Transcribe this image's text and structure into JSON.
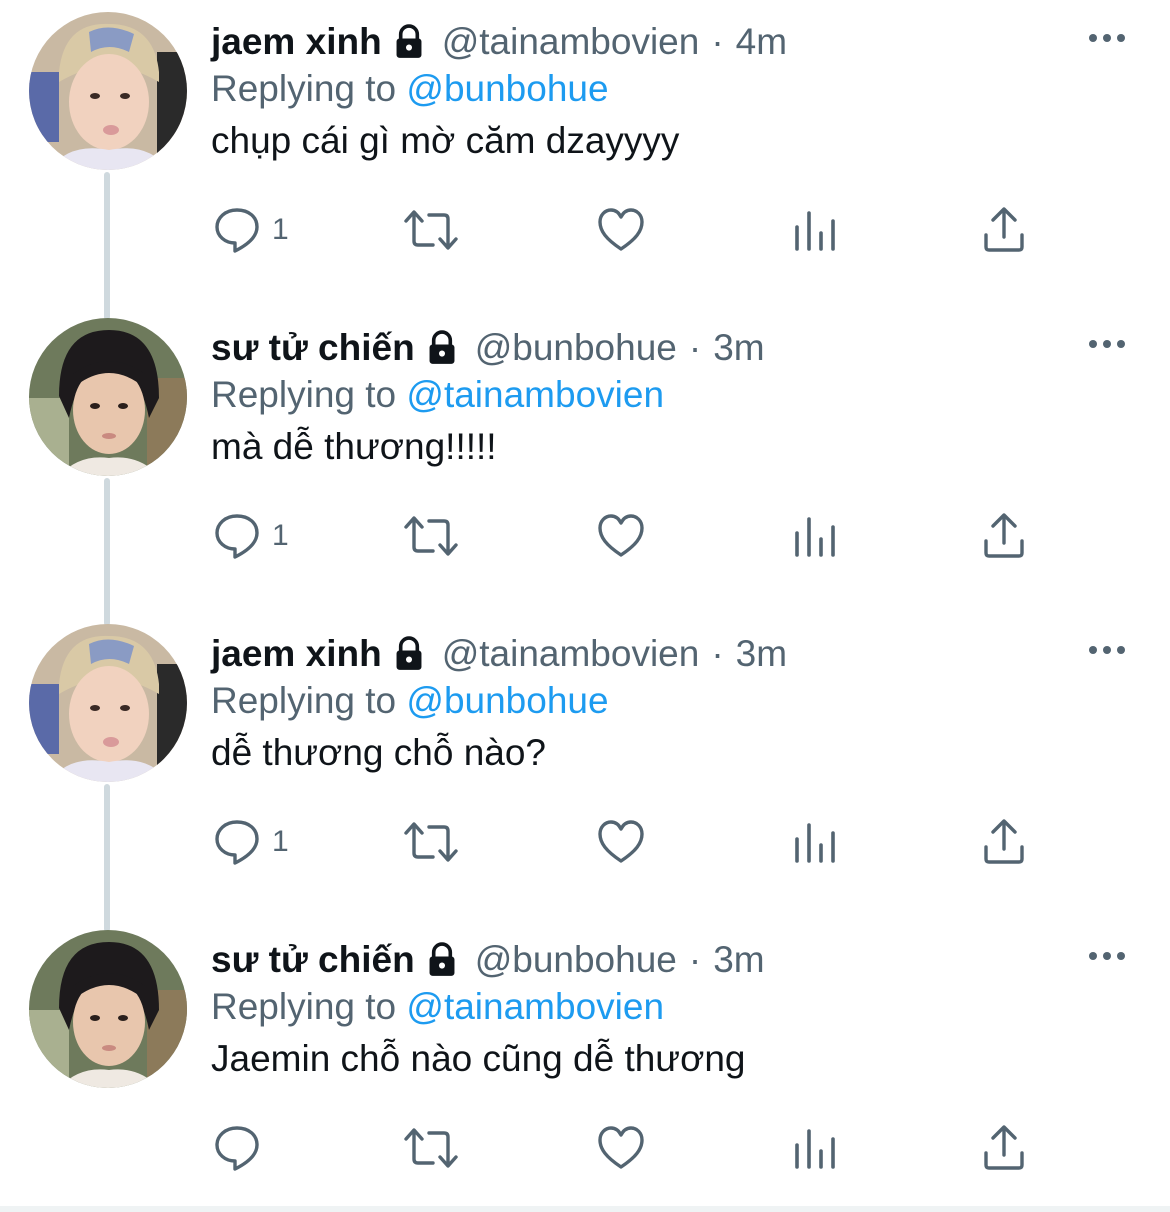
{
  "tweets": [
    {
      "name": "jaem xinh",
      "handle": "@tainambovien",
      "dot": "·",
      "time": "4m",
      "replying_prefix": "Replying to ",
      "replying_to": "@bunbohue",
      "text": "chụp cái gì mờ căm dzayyyy",
      "reply_count": "1",
      "avatar": "jaem"
    },
    {
      "name": "sư tử chiến",
      "handle": "@bunbohue",
      "dot": "·",
      "time": "3m",
      "replying_prefix": "Replying to ",
      "replying_to": "@tainambovien",
      "text": "mà dễ thương!!!!!",
      "reply_count": "1",
      "avatar": "chien"
    },
    {
      "name": "jaem xinh",
      "handle": "@tainambovien",
      "dot": "·",
      "time": "3m",
      "replying_prefix": "Replying to ",
      "replying_to": "@bunbohue",
      "text": "dễ thương chỗ nào?",
      "reply_count": "1",
      "avatar": "jaem"
    },
    {
      "name": "sư tử chiến",
      "handle": "@bunbohue",
      "dot": "·",
      "time": "3m",
      "replying_prefix": "Replying to ",
      "replying_to": "@tainambovien",
      "text": "Jaemin chỗ nào cũng dễ thương",
      "reply_count": "",
      "avatar": "chien"
    }
  ],
  "icons": {
    "reply": "reply-icon",
    "retweet": "retweet-icon",
    "like": "heart-icon",
    "stats": "analytics-icon",
    "share": "share-icon",
    "more": "more-icon",
    "lock": "lock-icon"
  },
  "colors": {
    "text": "#0f1419",
    "secondary": "#536471",
    "link": "#1d9bf0",
    "thread_line": "#cfd9de"
  }
}
